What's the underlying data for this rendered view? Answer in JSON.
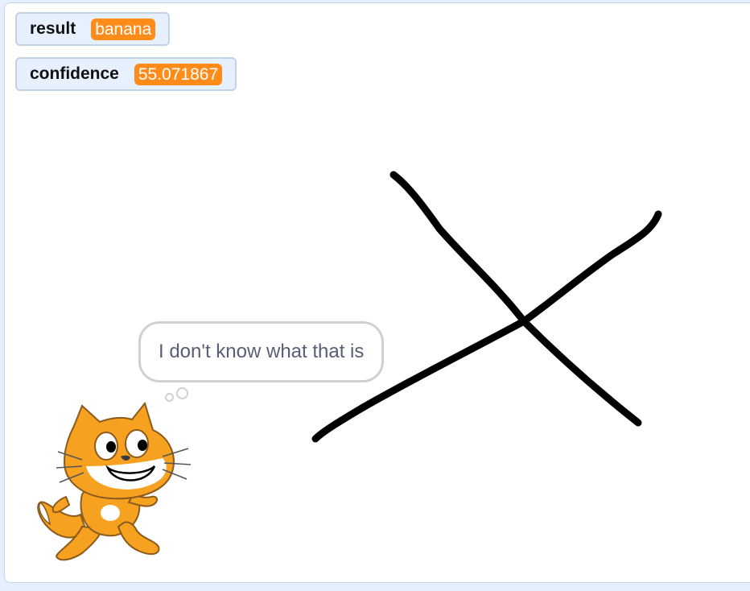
{
  "monitors": {
    "result": {
      "label": "result",
      "value": "banana"
    },
    "confidence": {
      "label": "confidence",
      "value": "55.071867"
    }
  },
  "sprite": {
    "name": "cat-sprite",
    "speech": "I don't know what that is"
  },
  "colors": {
    "stage_background": "#ffffff",
    "monitor_background": "#e6f0ff",
    "monitor_value_background": "#ff8c1a",
    "drawing_stroke": "#000000",
    "cat_orange": "#f6a11f"
  }
}
